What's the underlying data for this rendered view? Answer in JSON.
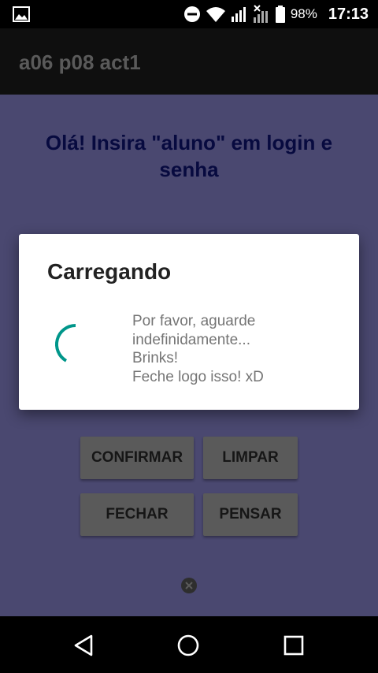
{
  "status_bar": {
    "battery_percent": "98%",
    "time": "17:13",
    "icons": [
      "gallery-icon",
      "do-not-disturb-icon",
      "wifi-icon",
      "signal-icon",
      "no-signal-icon",
      "battery-icon"
    ]
  },
  "app_bar": {
    "title": "a06 p08 act1"
  },
  "main": {
    "headline": "Olá! Insira \"aluno\" em login e senha",
    "buttons": {
      "confirm": "CONFIRMAR",
      "clear": "LIMPAR",
      "close": "FECHAR",
      "think": "PENSAR"
    }
  },
  "dialog": {
    "title": "Carregando",
    "message_lines": [
      "Por favor, aguarde",
      "indefinidamente...",
      "Brinks!",
      "Feche logo isso! xD"
    ],
    "spinner_color": "#00968a"
  },
  "colors": {
    "content_background": "#4a4870",
    "headline": "#070a3f",
    "accent": "#00968a"
  },
  "nav_bar": {
    "icons": [
      "back-icon",
      "home-icon",
      "recents-icon"
    ]
  }
}
